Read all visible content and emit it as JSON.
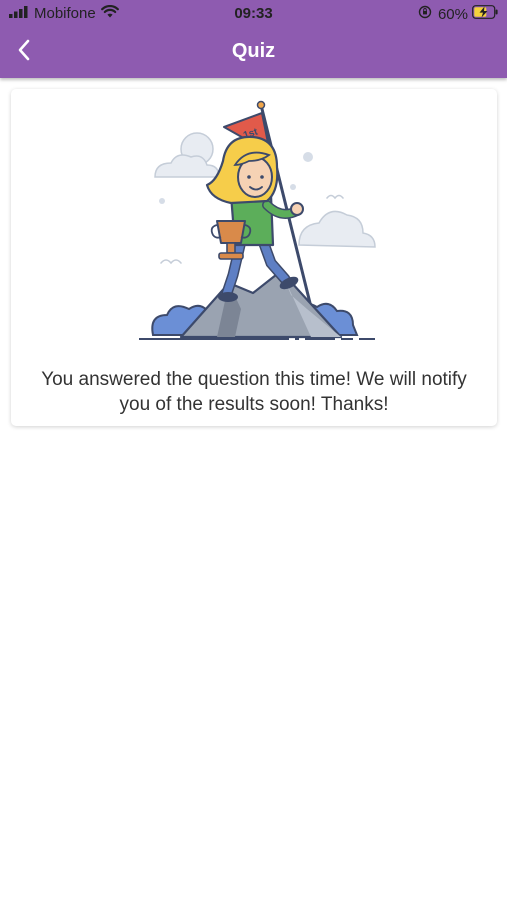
{
  "status_bar": {
    "carrier": "Mobifone",
    "time": "09:33",
    "battery": "60%",
    "icons": [
      "signal-icon",
      "wifi-icon",
      "orientation-lock-icon",
      "battery-charging-icon"
    ]
  },
  "header": {
    "title": "Quiz",
    "back_icon": "chevron-left-icon",
    "color": "#8e5bb0"
  },
  "card": {
    "illustration": "girl-on-mountain-with-flag-illustration",
    "flag_text": "1st",
    "message": "You answered the question this time! We will notify you of the results soon! Thanks!"
  }
}
